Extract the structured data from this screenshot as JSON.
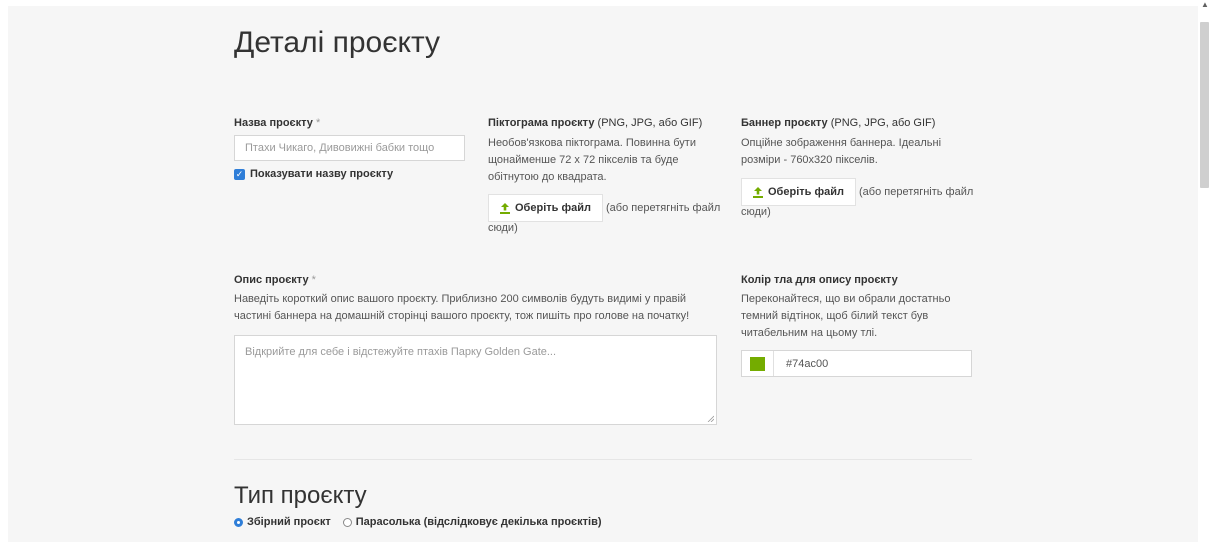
{
  "page_title": "Деталі проєкту",
  "project_name": {
    "label": "Назва проєкту",
    "required_mark": "*",
    "placeholder": "Птахи Чикаго, Дивовижні бабки тощо",
    "show_name_checkbox": {
      "label": "Показувати назву проєкту",
      "checked": true
    }
  },
  "project_icon": {
    "label": "Піктограма проєкту",
    "label_formats": "(PNG, JPG, або GIF)",
    "help_lines": [
      "Необов'язкова піктограма. Повинна бути",
      "щонайменше 72 x 72 пікселів та буде",
      "обітнутою до квадрата."
    ],
    "choose_button": "Оберіть файл",
    "drop_line1": "(або перетягніть файл",
    "drop_line2": "сюди)"
  },
  "project_banner": {
    "label": "Баннер проєкту",
    "label_formats": "(PNG, JPG, або GIF)",
    "help_lines": [
      "Опційне зображення баннера. Ідеальні",
      "розміри - 760x320 пікселів."
    ],
    "choose_button": "Оберіть файл",
    "drop_line1": "(або перетягніть файл",
    "drop_line2": "сюди)"
  },
  "project_description": {
    "label": "Опис проєкту",
    "required_mark": "*",
    "help_lines": [
      "Наведіть короткий опис вашого проєкту. Приблизно 200 символів будуть видимі у правій",
      "частині баннера на домашній сторінці вашого проєкту, тож пишіть про голове на початку!"
    ],
    "placeholder": "Відкрийте для себе і відстежуйте птахів Парку Golden Gate..."
  },
  "background_color": {
    "label": "Колір тла для опису проєкту",
    "help_lines": [
      "Переконайтеся, що ви обрали достатньо",
      "темний відтінок, щоб білий текст був",
      "читабельним на цьому тлі."
    ],
    "value": "#74ac00",
    "swatch_color": "#74ac00"
  },
  "project_type": {
    "title": "Тип проєкту",
    "options": [
      {
        "label": "Збірний проєкт",
        "selected": true
      },
      {
        "label": "Парасолька (відслідковує декілька проєктів)",
        "selected": false
      }
    ]
  },
  "colors": {
    "accent": "#2f7ed8",
    "upload_icon": "#74ac00"
  }
}
